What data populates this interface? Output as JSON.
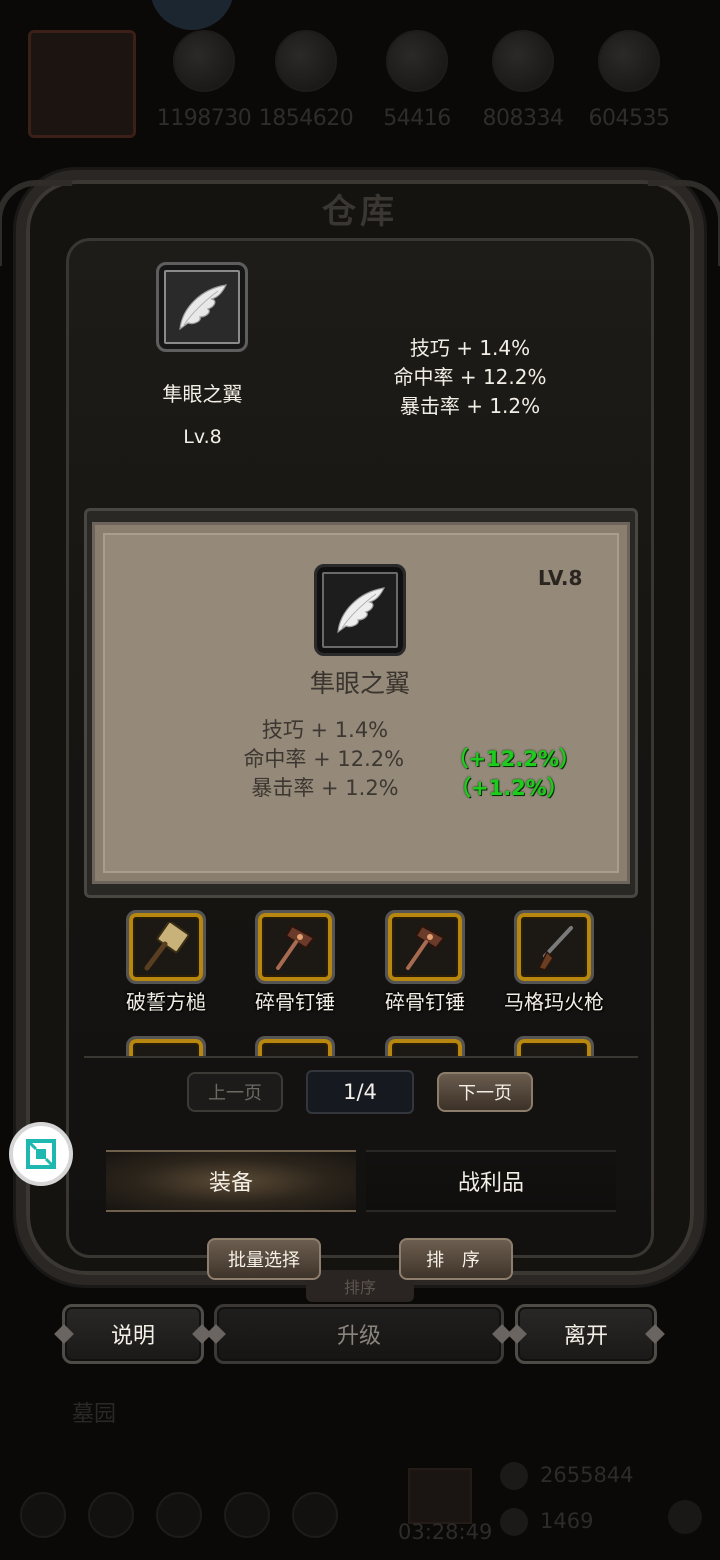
{
  "background": {
    "resources": [
      "1198730",
      "1854620",
      "54416",
      "808334",
      "604535"
    ],
    "graveyard_label": "墓园",
    "timer": "03:28:49",
    "gold": "2655844",
    "gems": "1469"
  },
  "window": {
    "title": "仓库"
  },
  "equipped": {
    "name": "隼眼之翼",
    "level": "Lv.8",
    "stats": [
      "技巧 + 1.4%",
      "命中率 + 12.2%",
      "暴击率 + 1.2%"
    ]
  },
  "detail": {
    "level": "LV.8",
    "name": "隼眼之翼",
    "stats": [
      {
        "text": "技巧 + 1.4%",
        "bonus": ""
      },
      {
        "text": "命中率 + 12.2%",
        "bonus": "（+12.2%）"
      },
      {
        "text": "暴击率 + 1.2%",
        "bonus": "（+1.2%）"
      }
    ]
  },
  "inventory": [
    {
      "label": "破誓方槌",
      "icon": "hammer-icon"
    },
    {
      "label": "碎骨钉锤",
      "icon": "spiked-mace-icon"
    },
    {
      "label": "碎骨钉锤",
      "icon": "spiked-mace-icon"
    },
    {
      "label": "马格玛火枪",
      "icon": "musket-icon"
    }
  ],
  "pagination": {
    "prev_label": "上一页",
    "next_label": "下一页",
    "current": "1/4"
  },
  "tabs": {
    "equipment": "装备",
    "loot": "战利品"
  },
  "actions": {
    "batch_select": "批量选择",
    "sort": "排 序",
    "sort_ghost": "排序"
  },
  "bottom": {
    "help": "说明",
    "upgrade": "升级",
    "exit": "离开"
  },
  "colors": {
    "bonus_green": "#1ecc1e",
    "parchment": "#958a7a"
  }
}
